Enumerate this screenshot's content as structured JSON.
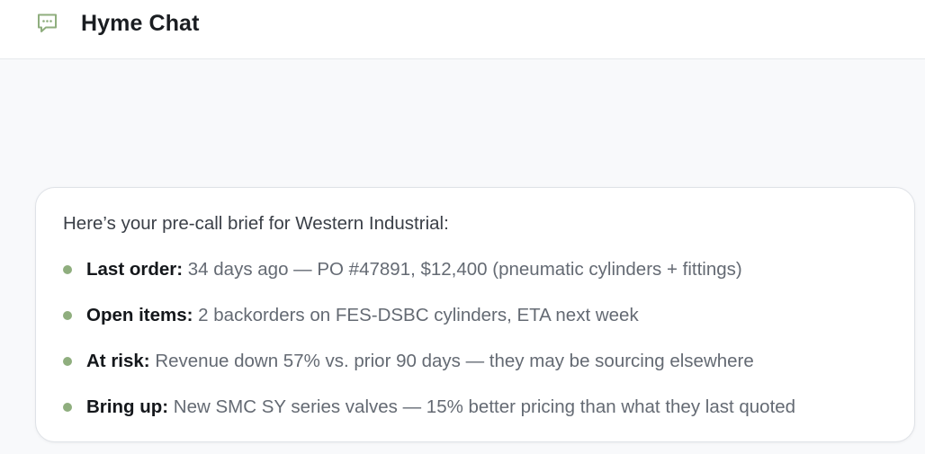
{
  "header": {
    "title": "Hyme Chat",
    "icon": "chat-bubble-icon",
    "icon_color": "#8fae7e"
  },
  "message": {
    "intro": "Here’s your pre-call brief for Western Industrial:",
    "items": [
      {
        "label": "Last order:",
        "text": "34 days ago — PO #47891, $12,400 (pneumatic cylinders + fittings)"
      },
      {
        "label": "Open items:",
        "text": "2 backorders on FES-DSBC cylinders, ETA next week"
      },
      {
        "label": "At risk:",
        "text": "Revenue down 57% vs. prior 90 days — they may be sourcing elsewhere"
      },
      {
        "label": "Bring up:",
        "text": "New SMC SY series valves — 15% better pricing than what they last quoted"
      }
    ],
    "bullet_color": "#8fae7e"
  }
}
